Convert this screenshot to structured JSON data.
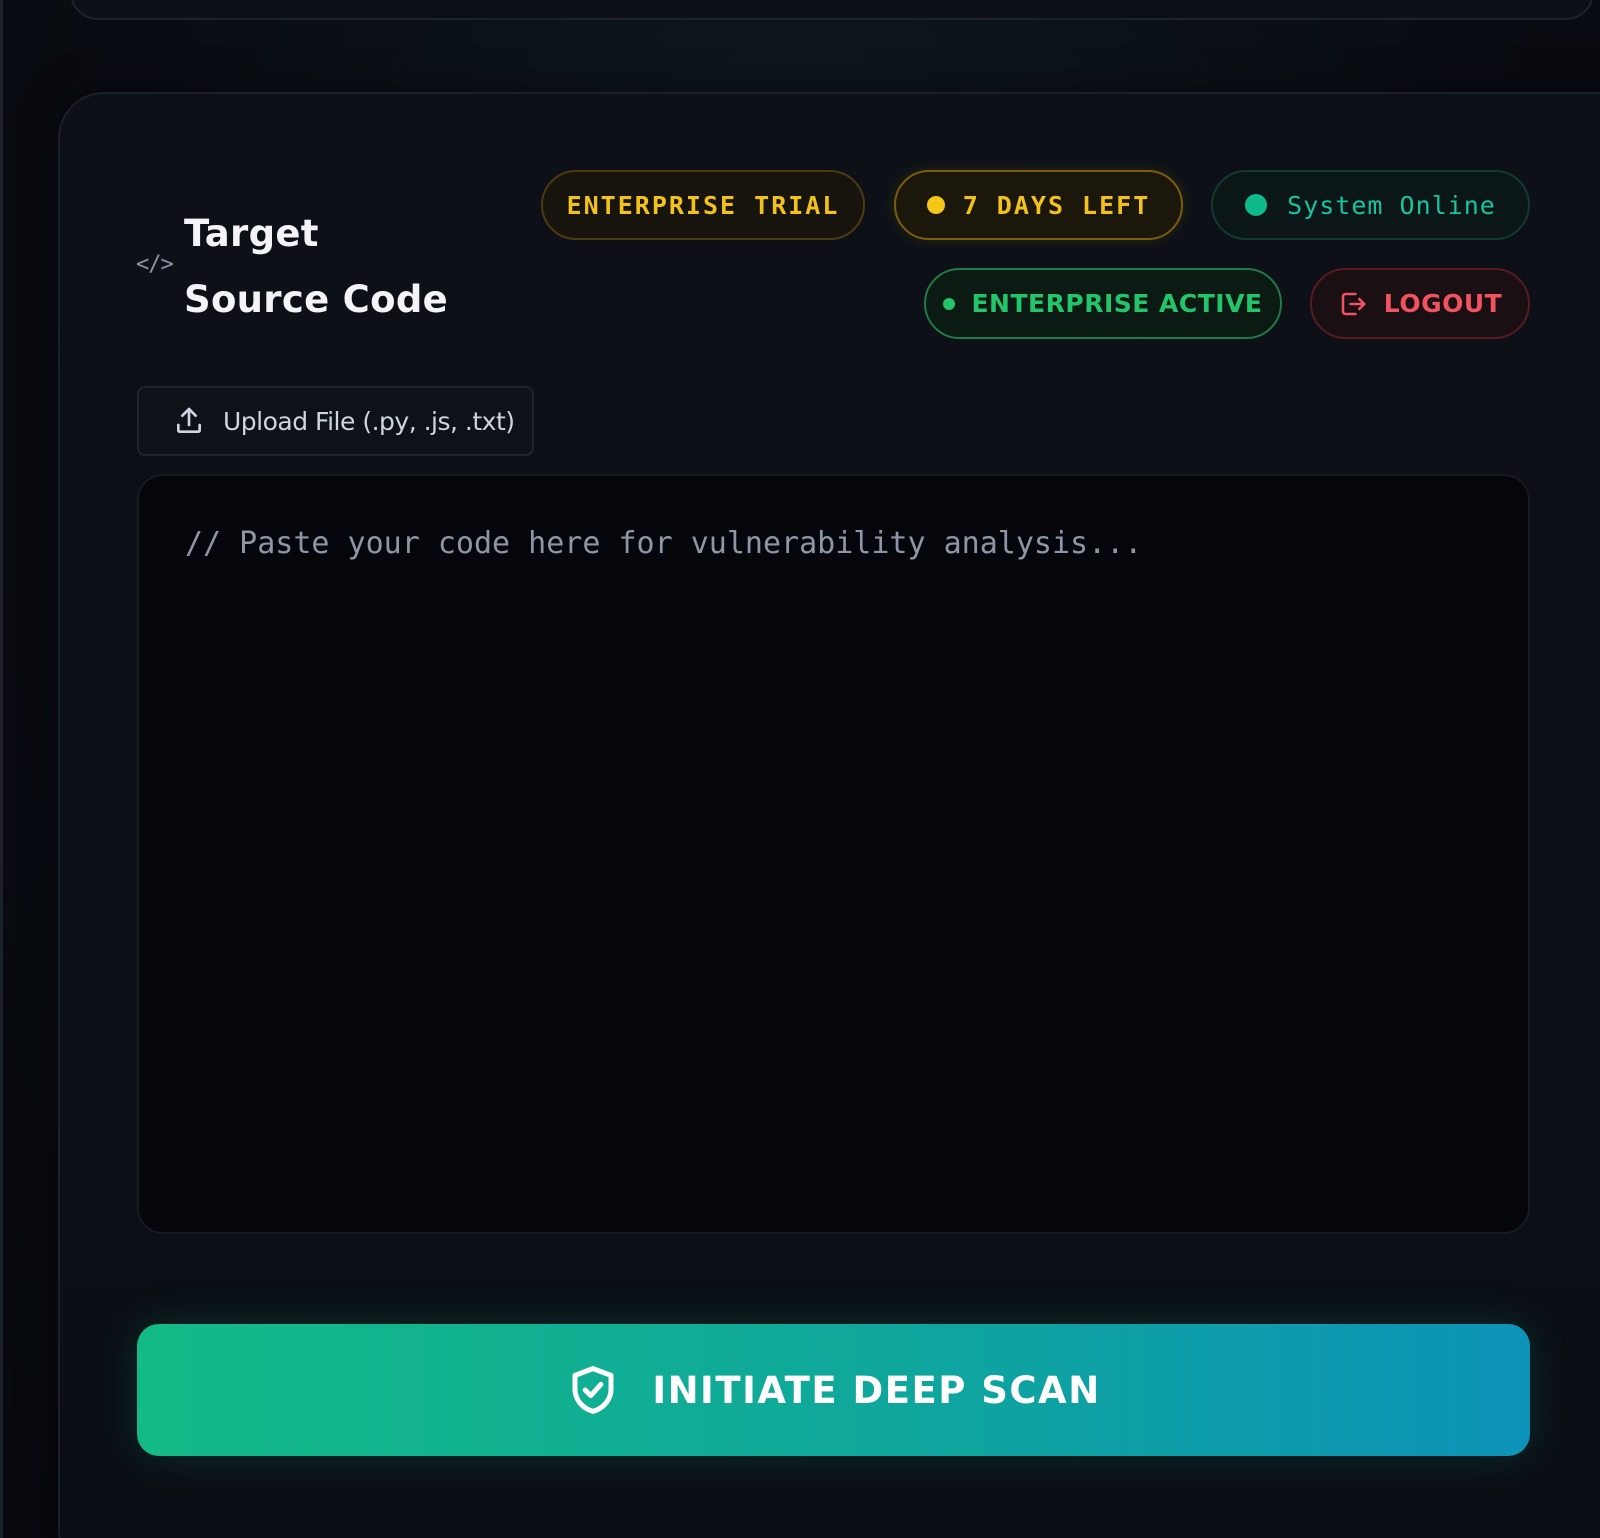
{
  "header": {
    "code_icon": "</>",
    "title_line1": "Target",
    "title_line2": "Source Code"
  },
  "badges": {
    "trial": "ENTERPRISE TRIAL",
    "days_left": "7 DAYS LEFT",
    "system_status": "System Online",
    "plan_status": "ENTERPRISE ACTIVE",
    "logout": "LOGOUT"
  },
  "upload": {
    "label": "Upload File (.py, .js, .txt)",
    "icon": "upload-icon"
  },
  "editor": {
    "placeholder": "// Paste your code here for vulnerability analysis...",
    "value": ""
  },
  "scan": {
    "label": "INITIATE DEEP SCAN",
    "icon": "shield-check-icon"
  },
  "colors": {
    "trial_yellow": "#f2c21b",
    "online_teal": "#18c3a0",
    "active_green": "#22c56a",
    "logout_red": "#f0535f",
    "scan_gradient_start": "#13ba86",
    "scan_gradient_end": "#0d93b8"
  }
}
